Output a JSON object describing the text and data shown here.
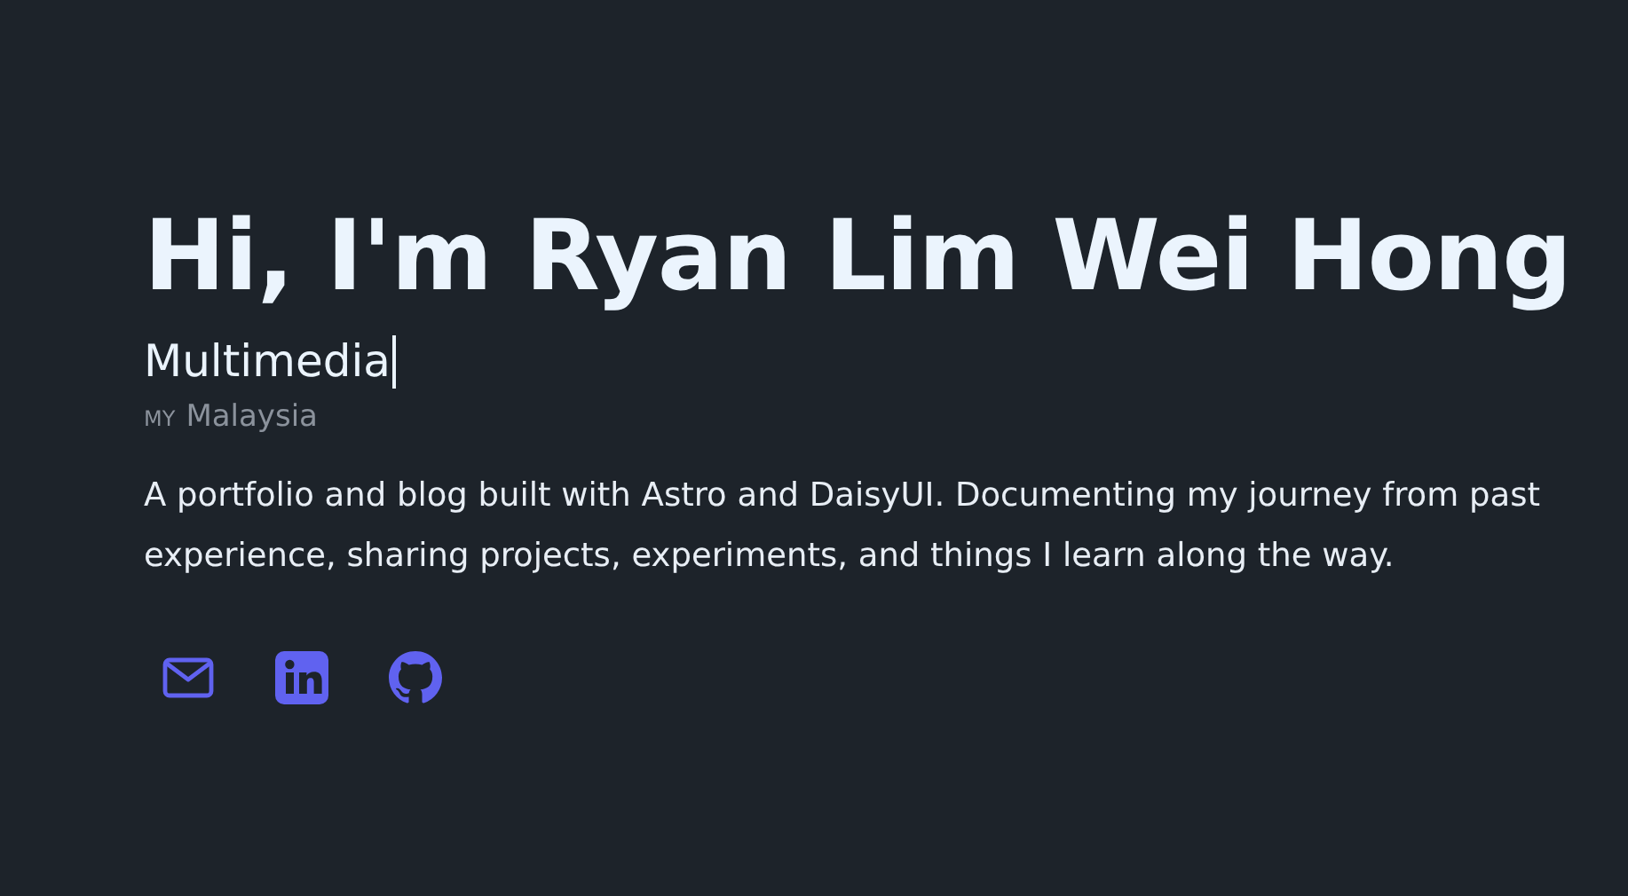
{
  "hero": {
    "title": "Hi, I'm Ryan Lim Wei Hong",
    "typed_role": "Multimedia",
    "location": {
      "flag": "MY",
      "name": "Malaysia"
    },
    "description": "A portfolio and blog built with Astro and DaisyUI. Documenting my journey from past experience, sharing projects, experiments, and things I learn along the way.",
    "links": [
      {
        "kind": "email"
      },
      {
        "kind": "linkedin"
      },
      {
        "kind": "github"
      }
    ]
  }
}
